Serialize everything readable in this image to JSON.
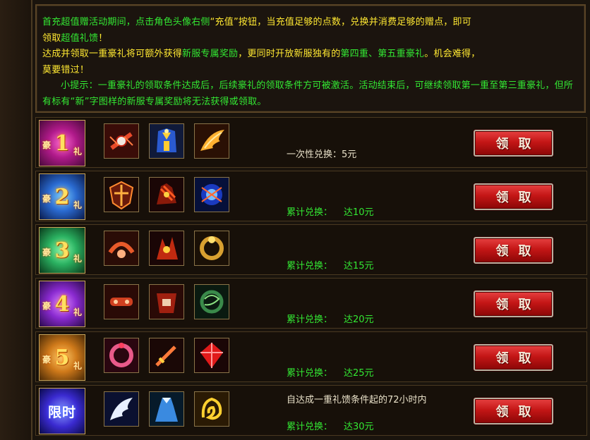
{
  "notice": {
    "line1_a": "首充超值赠活动期间，点击角色头像右侧",
    "line1_b": "“充值”",
    "line1_c": "按钮，当充值足够的点数，兑换并消费足够的赠点，即可",
    "line2_a": "领取",
    "line2_b": "超值礼馈",
    "line2_c": "！",
    "line3_a": "达成并领取一重豪礼将可额外获得",
    "line3_b": "新服专属奖励",
    "line3_c": "，更同时开放新服独有的",
    "line3_d": "第四重、第五重豪礼",
    "line3_e": "。机会难得，",
    "line4_a": "莫要错过",
    "line4_b": "！",
    "tip": "小提示：一重豪礼的领取条件达成后，后续豪礼的领取条件方可被激活。活动结束后，可继续领取第一重至第三重豪礼，但所有标有“新”字图样的新服专属奖励将无法获得或领取。"
  },
  "tiers": [
    {
      "badge_left": "豪",
      "badge_num": "1",
      "badge_right": "礼",
      "label": "一次性兑换：",
      "amount": "5元",
      "button": "领取"
    },
    {
      "badge_left": "豪",
      "badge_num": "2",
      "badge_right": "礼",
      "label": "累计兑换：",
      "amount": "达10元",
      "button": "领取"
    },
    {
      "badge_left": "豪",
      "badge_num": "3",
      "badge_right": "礼",
      "label": "累计兑换：",
      "amount": "达15元",
      "button": "领取"
    },
    {
      "badge_left": "豪",
      "badge_num": "4",
      "badge_right": "礼",
      "label": "累计兑换：",
      "amount": "达20元",
      "button": "领取"
    },
    {
      "badge_left": "豪",
      "badge_num": "5",
      "badge_right": "礼",
      "label": "累计兑换：",
      "amount": "达25元",
      "button": "领取"
    },
    {
      "badge_text": "限时",
      "condition": "自达成一重礼馈条件起的72小时内",
      "label": "累计兑换：",
      "amount": "达30元",
      "button": "领取"
    }
  ],
  "icons": [
    [
      "bracelet-icon",
      "armor-icon",
      "wing-icon"
    ],
    [
      "shield-icon",
      "gauntlet-icon",
      "orb-icon"
    ],
    [
      "necklace-icon",
      "claw-icon",
      "ring-icon"
    ],
    [
      "bracelet-icon",
      "belt-icon",
      "dragon-ring-icon"
    ],
    [
      "bracelet-icon",
      "sword-icon",
      "gem-icon"
    ],
    [
      "white-wing-icon",
      "dress-icon",
      "dragon-emblem-icon"
    ]
  ],
  "colors": {
    "highlight_yellow": "#ffe832",
    "highlight_green": "#33e833",
    "button_red": "#c41616"
  }
}
